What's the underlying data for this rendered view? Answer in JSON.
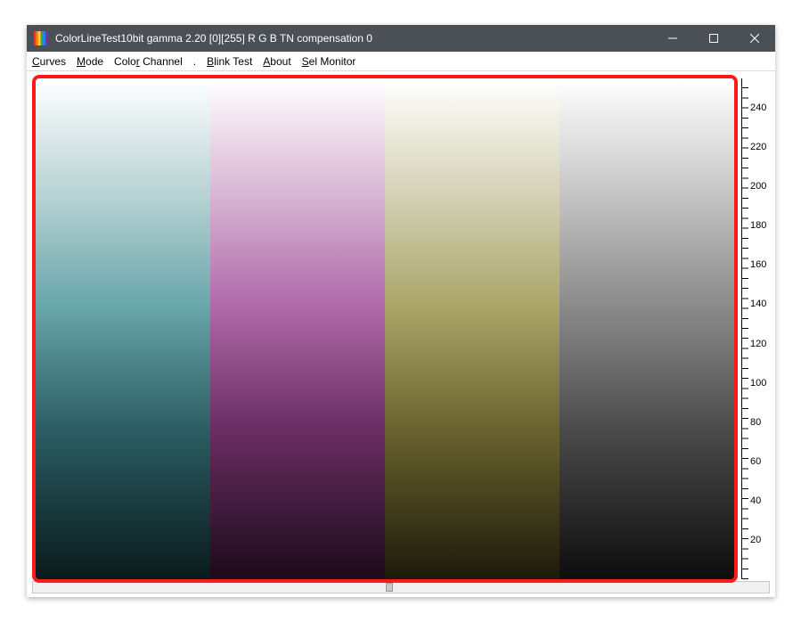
{
  "titlebar": {
    "title": "ColorLineTest10bit gamma 2.20 [0][255]   R G B   TN compensation 0"
  },
  "menubar": {
    "items": [
      {
        "pre": "",
        "u": "C",
        "post": "urves"
      },
      {
        "pre": "",
        "u": "M",
        "post": "ode"
      },
      {
        "pre": "Colo",
        "u": "r",
        "post": " Channel"
      },
      {
        "pre": "",
        "u": "B",
        "post": "link Test"
      },
      {
        "pre": "",
        "u": "A",
        "post": "bout"
      },
      {
        "pre": "",
        "u": "S",
        "post": "el Monitor"
      }
    ],
    "dot": "."
  },
  "ruler": {
    "labels": [
      "240",
      "220",
      "200",
      "180",
      "160",
      "140",
      "120",
      "100",
      "80",
      "60",
      "40",
      "20"
    ]
  },
  "columns": [
    "cyan",
    "magenta",
    "yellow",
    "grey"
  ]
}
